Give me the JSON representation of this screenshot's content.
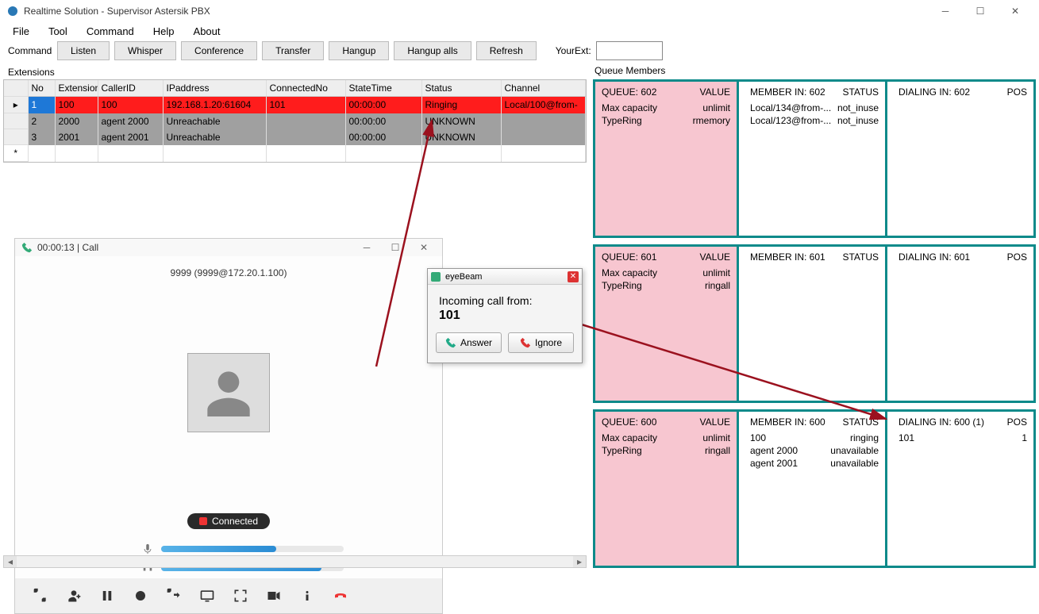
{
  "app": {
    "title": "Realtime Solution - Supervisor Astersik PBX"
  },
  "menu": {
    "file": "File",
    "tool": "Tool",
    "command": "Command",
    "help": "Help",
    "about": "About"
  },
  "cmd": {
    "label": "Command",
    "listen": "Listen",
    "whisper": "Whisper",
    "conference": "Conference",
    "transfer": "Transfer",
    "hangup": "Hangup",
    "hangupalls": "Hangup alls",
    "refresh": "Refresh",
    "yourext": "YourExt:",
    "ext_value": ""
  },
  "extensions": {
    "label": "Extensions",
    "cols": {
      "no": "No",
      "extension": "Extension",
      "callerid": "CallerID",
      "ipaddress": "IPaddress",
      "connectedno": "ConnectedNo",
      "statetime": "StateTime",
      "status": "Status",
      "channel": "Channel"
    },
    "rows": [
      {
        "no": "1",
        "ext": "100",
        "cid": "100",
        "ip": "192.168.1.20:61604",
        "conn": "101",
        "time": "00:00:00",
        "status": "Ringing",
        "chan": "Local/100@from-"
      },
      {
        "no": "2",
        "ext": "2000",
        "cid": "agent 2000",
        "ip": "Unreachable",
        "conn": "",
        "time": "00:00:00",
        "status": "UNKNOWN",
        "chan": ""
      },
      {
        "no": "3",
        "ext": "2001",
        "cid": "agent 2001",
        "ip": "Unreachable",
        "conn": "",
        "time": "00:00:00",
        "status": "UNKNOWN",
        "chan": ""
      }
    ]
  },
  "call": {
    "title": "00:00:13 | Call",
    "caller": "9999 (9999@172.20.1.100)",
    "status": "Connected"
  },
  "eyebeam": {
    "title": "eyeBeam",
    "line1": "Incoming call from:",
    "line2": "101",
    "answer": "Answer",
    "ignore": "Ignore"
  },
  "queues": {
    "label": "Queue Members",
    "rows": [
      {
        "queue": {
          "name": "QUEUE: 602",
          "valhdr": "VALUE",
          "props": [
            [
              "Max capacity",
              "unlimit"
            ],
            [
              "TypeRing",
              "rmemory"
            ]
          ]
        },
        "member": {
          "name": "MEMBER IN: 602",
          "stathdr": "STATUS",
          "items": [
            [
              "Local/134@from-...",
              "not_inuse"
            ],
            [
              "Local/123@from-...",
              "not_inuse"
            ]
          ]
        },
        "dial": {
          "name": "DIALING IN: 602",
          "poshdr": "POS",
          "items": []
        }
      },
      {
        "queue": {
          "name": "QUEUE: 601",
          "valhdr": "VALUE",
          "props": [
            [
              "Max capacity",
              "unlimit"
            ],
            [
              "TypeRing",
              "ringall"
            ]
          ]
        },
        "member": {
          "name": "MEMBER IN: 601",
          "stathdr": "STATUS",
          "items": []
        },
        "dial": {
          "name": "DIALING IN: 601",
          "poshdr": "POS",
          "items": []
        }
      },
      {
        "queue": {
          "name": "QUEUE: 600",
          "valhdr": "VALUE",
          "props": [
            [
              "Max capacity",
              "unlimit"
            ],
            [
              "TypeRing",
              "ringall"
            ]
          ]
        },
        "member": {
          "name": "MEMBER IN: 600",
          "stathdr": "STATUS",
          "items": [
            [
              "100",
              "ringing"
            ],
            [
              "agent 2000",
              "unavailable"
            ],
            [
              "agent 2001",
              "unavailable"
            ]
          ]
        },
        "dial": {
          "name": "DIALING IN: 600 (1)",
          "poshdr": "POS",
          "items": [
            [
              "101",
              "1"
            ]
          ]
        }
      }
    ]
  }
}
